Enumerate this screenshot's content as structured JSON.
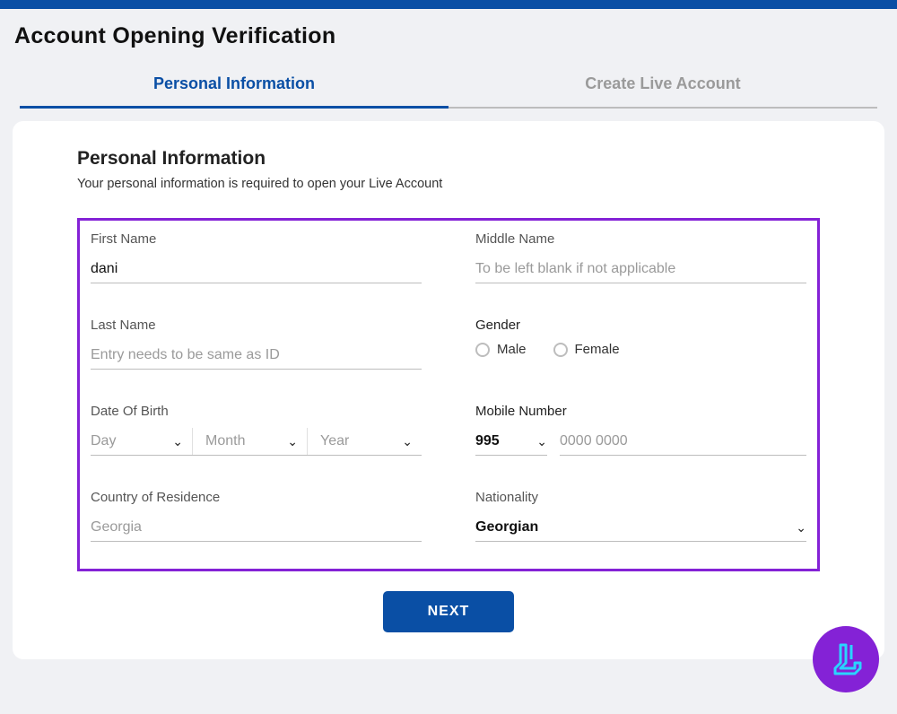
{
  "header": {
    "title": "Account Opening Verification"
  },
  "tabs": {
    "personal": "Personal Information",
    "live": "Create Live Account"
  },
  "section": {
    "title": "Personal Information",
    "subtitle": "Your personal information is required to open your Live Account"
  },
  "fields": {
    "first_name": {
      "label": "First Name",
      "value": "dani"
    },
    "middle_name": {
      "label": "Middle Name",
      "placeholder": "To be left blank if not applicable"
    },
    "last_name": {
      "label": "Last Name",
      "placeholder": "Entry needs to be same as ID"
    },
    "gender": {
      "label": "Gender",
      "options": {
        "male": "Male",
        "female": "Female"
      }
    },
    "dob": {
      "label": "Date Of Birth",
      "day": "Day",
      "month": "Month",
      "year": "Year"
    },
    "mobile": {
      "label": "Mobile Number",
      "code": "995",
      "placeholder": "0000 0000"
    },
    "country": {
      "label": "Country of Residence",
      "value": "Georgia"
    },
    "nationality": {
      "label": "Nationality",
      "value": "Georgian"
    }
  },
  "buttons": {
    "next": "NEXT"
  }
}
